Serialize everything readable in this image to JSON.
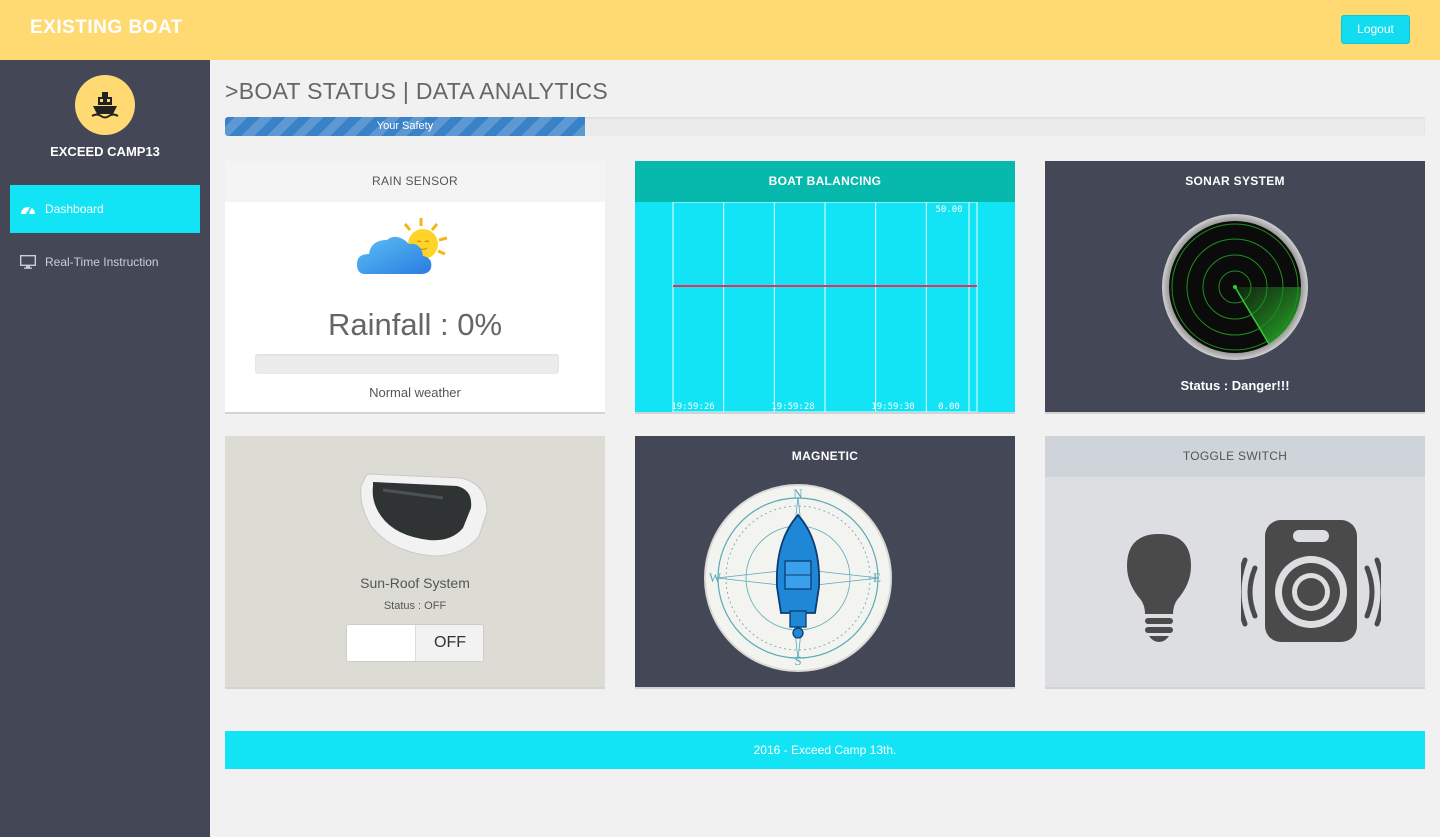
{
  "header": {
    "brand": "EXISTING BOAT",
    "logout_label": "Logout"
  },
  "sidebar": {
    "user_name": "EXCEED CAMP13",
    "items": [
      {
        "label": "Dashboard",
        "icon": "dashboard-icon",
        "active": true
      },
      {
        "label": "Real-Time Instruction",
        "icon": "monitor-icon",
        "active": false
      }
    ]
  },
  "main": {
    "title": ">BOAT STATUS | DATA ANALYTICS",
    "safety": {
      "label": "Your Safety",
      "percent": 30
    }
  },
  "cards": {
    "rain": {
      "title": "RAIN SENSOR",
      "value_text": "Rainfall : 0%",
      "percent": 0,
      "weather": "Normal weather",
      "icon": "sun-cloud-icon"
    },
    "balancing": {
      "title": "BOAT BALANCING",
      "chart_data": {
        "type": "line",
        "x": [
          "19:59:26",
          "19:59:28",
          "19:59:30"
        ],
        "ytick_labels": [
          "50.00",
          "0.00"
        ],
        "ylim": [
          0,
          50
        ],
        "series": [
          {
            "values": [
              30,
              30,
              30,
              30
            ]
          }
        ],
        "line_color": "#e83060",
        "grid": true
      }
    },
    "sonar": {
      "title": "SONAR SYSTEM",
      "status": "Status : Danger!!!",
      "icon": "radar-icon"
    },
    "roof": {
      "title": "Sun-Roof System",
      "status": "Status : OFF",
      "toggle_label": "OFF",
      "icon": "sunroof-icon"
    },
    "magnetic": {
      "title": "MAGNETIC",
      "compass": {
        "n": "N",
        "s": "S",
        "e": "E",
        "w": "W"
      },
      "icon": "compass-boat-icon"
    },
    "toggle": {
      "title": "TOGGLE SWITCH",
      "icons": [
        "light-bulb-icon",
        "speaker-icon"
      ]
    }
  },
  "footer": {
    "text": "2016 - Exceed Camp 13th."
  },
  "colors": {
    "accent": "#12e4f5",
    "header": "#ffd971",
    "sidebar": "#434756",
    "teal": "#07b8ad"
  }
}
